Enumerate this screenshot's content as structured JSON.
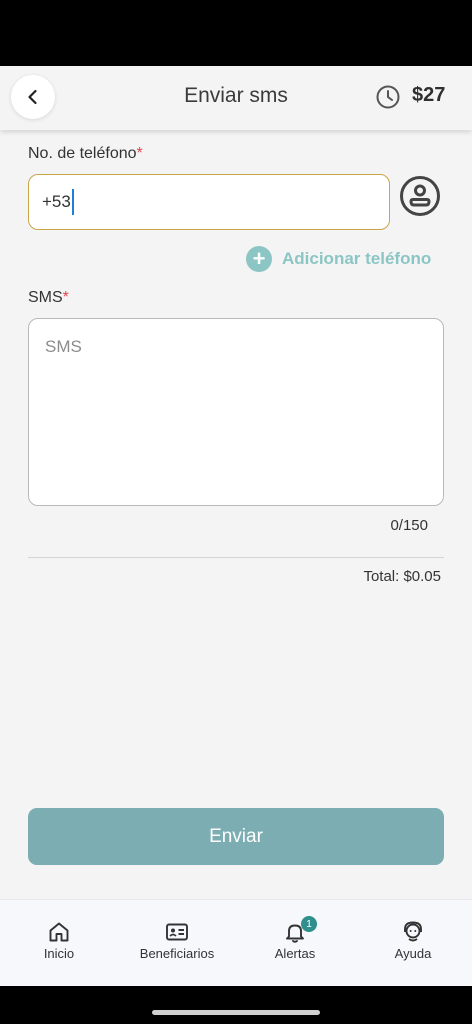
{
  "header": {
    "title": "Enviar sms",
    "balance": "$27",
    "icons": {
      "back": "chevron-left-icon",
      "history": "clock-icon"
    }
  },
  "form": {
    "phone_label": "No. de teléfono",
    "phone_value": "+53",
    "contact_icon": "contact-avatar-icon",
    "add_phone_label": "Adicionar teléfono",
    "sms_label": "SMS",
    "sms_placeholder": "SMS",
    "required_mark": "*",
    "counter": "0/150",
    "total": "Total: $0.05"
  },
  "actions": {
    "send_label": "Enviar"
  },
  "tabbar": {
    "items": [
      {
        "label": "Inicio",
        "icon": "home-icon"
      },
      {
        "label": "Beneficiarios",
        "icon": "id-card-icon"
      },
      {
        "label": "Alertas",
        "icon": "bell-icon",
        "badge": "1"
      },
      {
        "label": "Ayuda",
        "icon": "support-agent-icon"
      }
    ]
  },
  "colors": {
    "accent": "#7badb2",
    "add_link": "#8cc6c4",
    "input_focus_border": "#c9a54a",
    "required": "#e0464e",
    "badge": "#2f8f8d"
  }
}
